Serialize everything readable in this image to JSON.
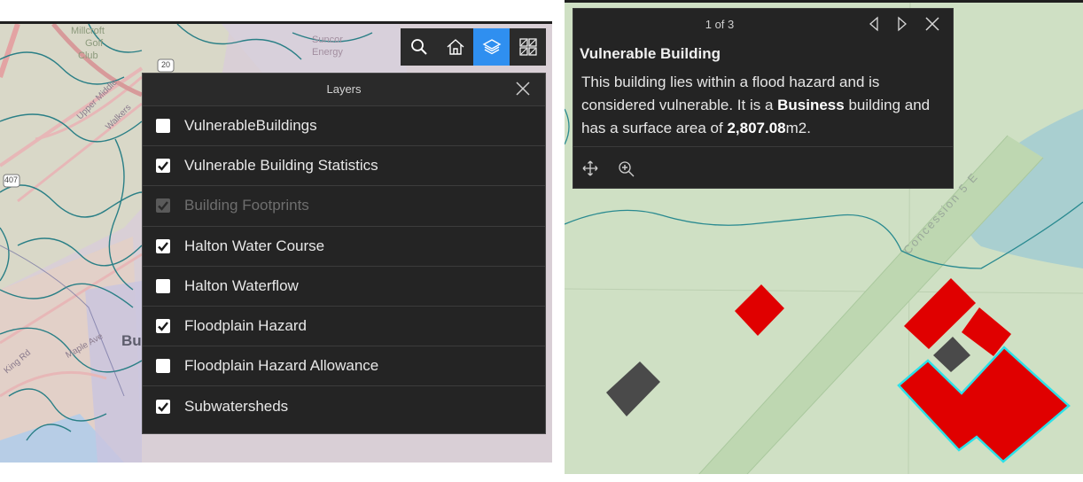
{
  "map_left": {
    "labels": {
      "millcroft": "Millcroft",
      "golf": "Golf",
      "club": "Club",
      "suncor": "Suncor",
      "energy": "Energy",
      "road_20": "20",
      "road_407": "407",
      "burlington_partial": "Bu",
      "walkers": "Walkers",
      "upper_middle": "Upper Middle",
      "king_rd": "King Rd",
      "maple_ave": "Maple Ave"
    },
    "toolbar": {
      "search": "search-icon",
      "home": "home-icon",
      "layers": "layers-icon",
      "basemap": "basemap-gallery-icon",
      "active_color": "#2f8ff0"
    },
    "layers_panel": {
      "title": "Layers",
      "items": [
        {
          "label": "VulnerableBuildings",
          "checked": false,
          "disabled": false
        },
        {
          "label": "Vulnerable Building Statistics",
          "checked": true,
          "disabled": false
        },
        {
          "label": "Building Footprints",
          "checked": true,
          "disabled": true
        },
        {
          "label": "Halton Water Course",
          "checked": true,
          "disabled": false
        },
        {
          "label": "Halton Waterflow",
          "checked": false,
          "disabled": false
        },
        {
          "label": "Floodplain Hazard",
          "checked": true,
          "disabled": false
        },
        {
          "label": "Floodplain Hazard Allowance",
          "checked": false,
          "disabled": false
        },
        {
          "label": "Subwatersheds",
          "checked": true,
          "disabled": false
        }
      ]
    }
  },
  "map_right": {
    "road_label": "Concession 5 E",
    "building_color": "#e00000",
    "highlight_color": "#2de0e8",
    "popup": {
      "count": "1 of 3",
      "title": "Vulnerable Building",
      "body": {
        "part1": "This building lies within a flood hazard and is considered vulnerable. It is a ",
        "type": "Business",
        "part2": " building and has a surface area of ",
        "area": "2,807.08",
        "unit": "m2."
      }
    }
  }
}
